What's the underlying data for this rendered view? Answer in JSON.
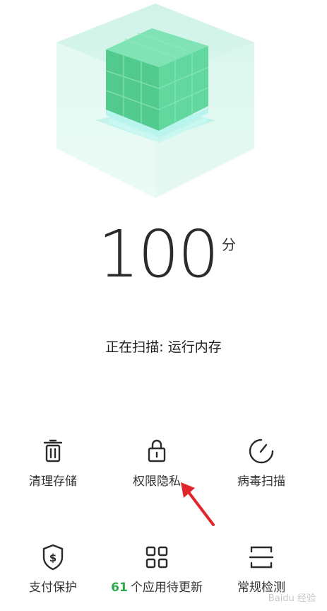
{
  "score": {
    "value": "100",
    "unit": "分"
  },
  "status": {
    "text": "正在扫描: 运行内存"
  },
  "tools": [
    {
      "label": "清理存储",
      "icon": "trash-icon"
    },
    {
      "label": "权限隐私",
      "icon": "lock-icon"
    },
    {
      "label": "病毒扫描",
      "icon": "gauge-icon"
    },
    {
      "label": "支付保护",
      "icon": "shield-dollar-icon"
    },
    {
      "count": "61",
      "label": "个应用待更新",
      "icon": "app-grid-icon"
    },
    {
      "label": "常规检测",
      "icon": "scan-icon"
    }
  ],
  "watermark": "Baidu 经验",
  "colors": {
    "accent_green": "#2ba84a",
    "cube_green": "#5fd4a0",
    "arrow_red": "#e0262b"
  }
}
